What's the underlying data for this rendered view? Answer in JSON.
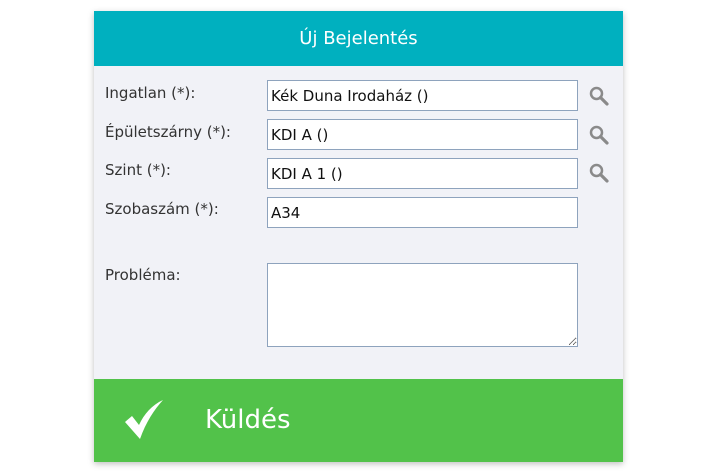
{
  "header": {
    "title": "Új Bejelentés"
  },
  "form": {
    "property": {
      "label": "Ingatlan (*):",
      "value": "Kék Duna Irodaház ()"
    },
    "wing": {
      "label": "Épületszárny (*):",
      "value": "KDI A ()"
    },
    "floor": {
      "label": "Szint (*):",
      "value": "KDI A 1 ()"
    },
    "room": {
      "label": "Szobaszám (*):",
      "value": "A34"
    },
    "problem": {
      "label": "Probléma:",
      "value": ""
    }
  },
  "footer": {
    "submit_label": "Küldés"
  },
  "icons": {
    "search": "search-icon",
    "submit": "checkmark-icon"
  },
  "colors": {
    "header": "#00b0bf",
    "submit": "#52c24a",
    "panel": "#f1f2f7",
    "icon": "#8a8a8a"
  }
}
